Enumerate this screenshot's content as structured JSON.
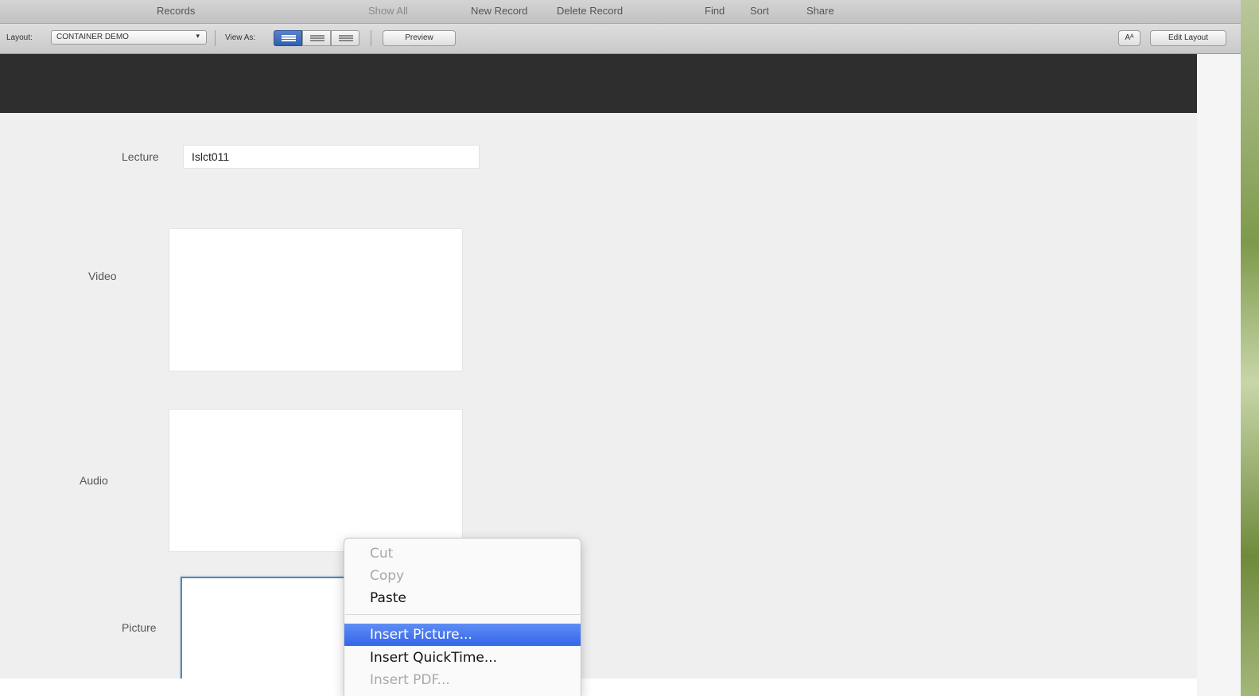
{
  "toolbar": {
    "records_label": "Records",
    "show_all_label": "Show All",
    "new_record_label": "New Record",
    "delete_record_label": "Delete Record",
    "find_label": "Find",
    "sort_label": "Sort",
    "share_label": "Share"
  },
  "layout_bar": {
    "layout_label": "Layout:",
    "layout_value": "CONTAINER DEMO",
    "view_as_label": "View As:",
    "view_modes": [
      "form-view-icon",
      "list-view-icon",
      "table-view-icon"
    ],
    "active_view": "form",
    "preview_label": "Preview",
    "font_size_label": "Aᴬ",
    "edit_layout_label": "Edit Layout"
  },
  "form": {
    "lecture_label": "Lecture",
    "lecture_value": "Islct011",
    "video_label": "Video",
    "audio_label": "Audio",
    "picture_label": "Picture"
  },
  "context_menu": {
    "items": [
      {
        "label": "Cut",
        "enabled": false
      },
      {
        "label": "Copy",
        "enabled": false
      },
      {
        "label": "Paste",
        "enabled": true
      },
      {
        "label": "Insert Picture...",
        "enabled": true,
        "highlighted": true
      },
      {
        "label": "Insert QuickTime...",
        "enabled": true
      },
      {
        "label": "Insert PDF...",
        "enabled": false
      }
    ]
  },
  "colors": {
    "header_band": "#2e2e2e",
    "highlight": "#3f74ee",
    "content_bg": "#efefef"
  }
}
